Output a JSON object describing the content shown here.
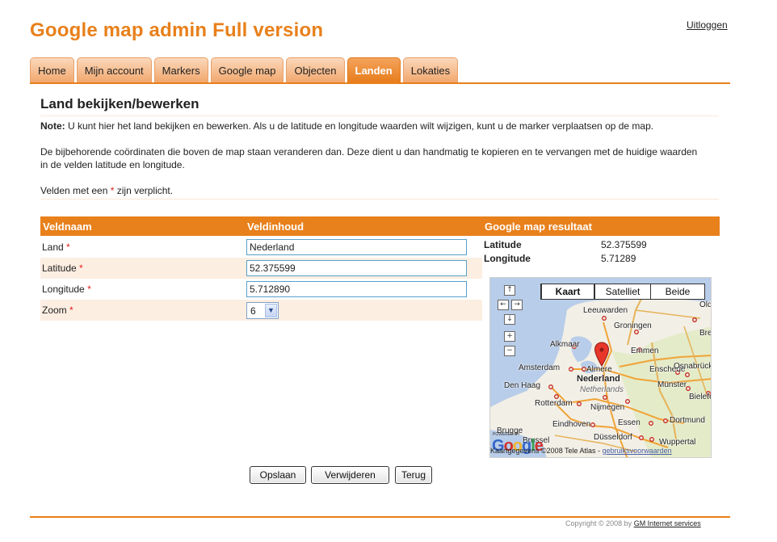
{
  "app": {
    "title": "Google map admin Full version",
    "logout_label": "Uitloggen"
  },
  "tabs": [
    {
      "label": "Home"
    },
    {
      "label": "Mijn account"
    },
    {
      "label": "Markers"
    },
    {
      "label": "Google map"
    },
    {
      "label": "Objecten"
    },
    {
      "label": "Landen",
      "active": true
    },
    {
      "label": "Lokaties"
    }
  ],
  "page": {
    "title": "Land bekijken/bewerken",
    "note_label": "Note:",
    "note_text": " U kunt hier het land bekijken en bewerken. Als u de latitude en longitude waarden wilt wijzigen, kunt u de marker verplaatsen op de map.",
    "coords_text": "De bijbehorende coördinaten die boven de map staan veranderen dan. Deze dient u dan handmatig te kopieren en te vervangen met de huidige waarden in de velden latitude en longitude.",
    "required_prefix": "Velden met een ",
    "required_star": "*",
    "required_suffix": " zijn verplicht."
  },
  "form": {
    "col_name": "Veldnaam",
    "col_value": "Veldinhoud",
    "fields": [
      {
        "label": "Land",
        "required": "*",
        "value": "Nederland"
      },
      {
        "label": "Latitude",
        "required": "*",
        "value": "52.375599"
      },
      {
        "label": "Longitude",
        "required": "*",
        "value": "5.712890"
      }
    ],
    "zoom": {
      "label": "Zoom",
      "required": "*",
      "value": "6"
    }
  },
  "map_result": {
    "title": "Google map resultaat",
    "latitude_label": "Latitude",
    "latitude_value": "52.375599",
    "longitude_label": "Longitude",
    "longitude_value": "5.71289"
  },
  "map": {
    "types": [
      "Kaart",
      "Satelliet",
      "Beide"
    ],
    "selected_type": "Kaart",
    "cities": {
      "leeuwarden": "Leeuwarden",
      "groningen": "Groningen",
      "alkmaar": "Alkmaar",
      "emmen": "Emmen",
      "amsterdam": "Amsterdam",
      "almere": "Almere",
      "enschede": "Enschede",
      "osnabruck": "Osnabrück",
      "nederland": "Nederland",
      "netherlands": "Netherlands",
      "den_haag": "Den Haag",
      "munster": "Münster",
      "rotterdam": "Rotterdam",
      "nijmegen": "Nijmegen",
      "bielefeld": "Bielefe",
      "eindhoven": "Eindhoven",
      "essen": "Essen",
      "dortmund": "Dortmund",
      "brugge": "Brugge",
      "brussel": "Brussel",
      "dusseldorf": "Düsseldorf",
      "wuppertal": "Wuppertal",
      "oldenburg": "Old",
      "bremen": "Bre"
    },
    "powered_by": "POWERED BY",
    "logo_text": "Google",
    "copyright_text": "Kaartgegevens ©2008 Tele Atlas -",
    "terms_link": "gebruiksvoorwaarden"
  },
  "buttons": {
    "save": "Opslaan",
    "delete": "Verwijderen",
    "back": "Terug"
  },
  "footer": {
    "copyright": "Copyright © 2008 by ",
    "company_link": "GM Internet services"
  },
  "colors": {
    "accent": "#e8801b",
    "row_alt": "#fdeee2",
    "required": "#e0201b"
  }
}
